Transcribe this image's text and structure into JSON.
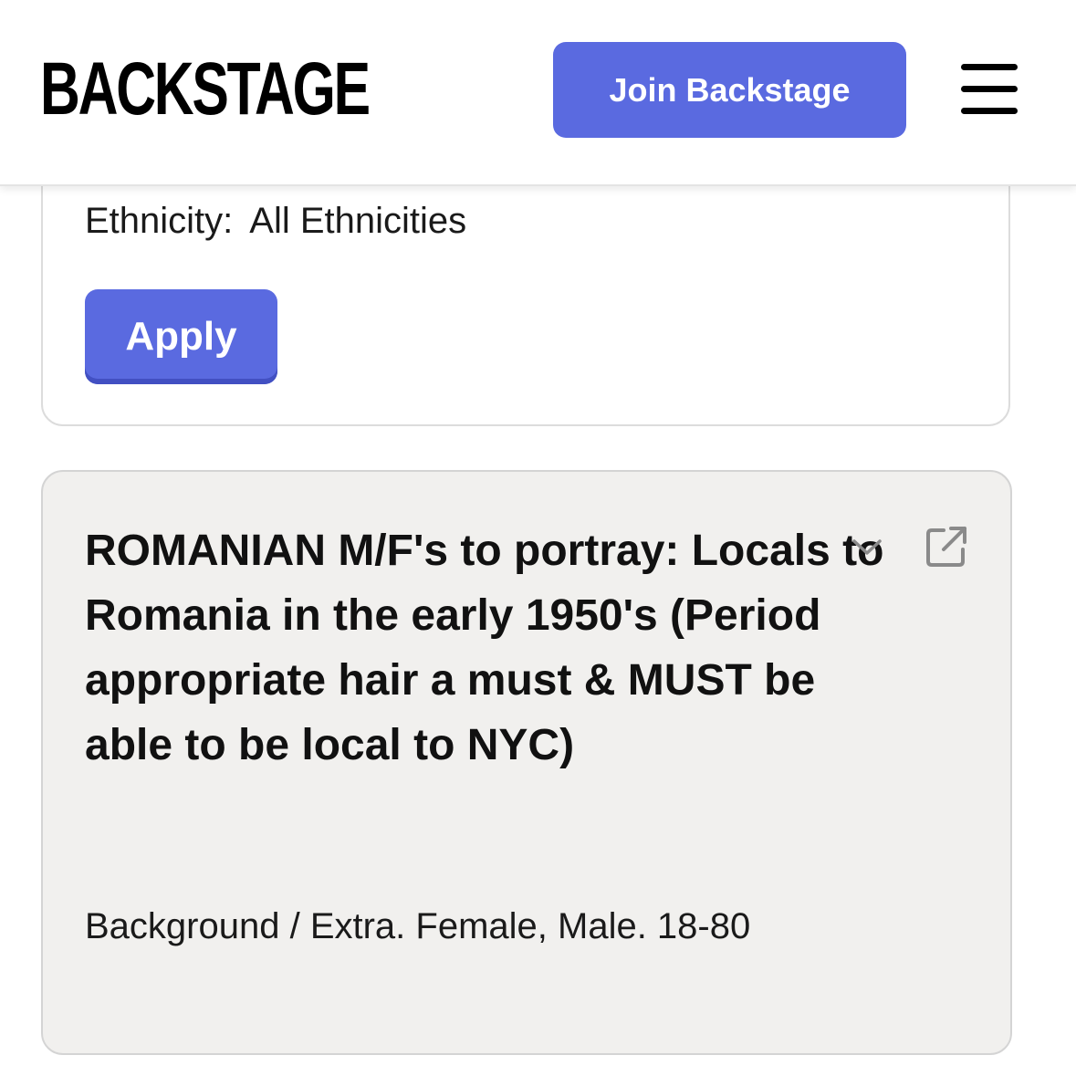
{
  "header": {
    "logo": "BACKSTAGE",
    "join_label": "Join Backstage",
    "menu_icon": "hamburger-menu-icon",
    "accent_color": "#5a6ae0"
  },
  "filter": {
    "ethnicity_label": "Ethnicity:",
    "ethnicity_value": "All Ethnicities",
    "apply_label": "Apply"
  },
  "role": {
    "title": "ROMANIAN M/F's to portray: Locals to Romania in the early 1950's (Period appropriate hair a must & MUST be able to be local to NYC)",
    "meta": "Background / Extra. Female, Male. 18-80",
    "expand_icon": "chevron-down-icon",
    "open_icon": "external-link-icon"
  }
}
